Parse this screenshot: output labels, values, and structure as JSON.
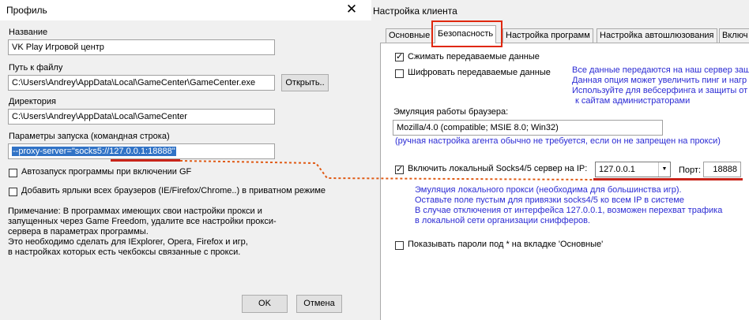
{
  "profile": {
    "title": "Профиль",
    "close_glyph": "✕",
    "name_label": "Название",
    "name_value": "VK Play Игровой центр",
    "path_label": "Путь к файлу",
    "path_value": "C:\\Users\\Andrey\\AppData\\Local\\GameCenter\\GameCenter.exe",
    "open_button": "Открыть..",
    "dir_label": "Директория",
    "dir_value": "C:\\Users\\Andrey\\AppData\\Local\\GameCenter",
    "params_label": "Параметры запуска (командная строка)",
    "params_value": "--proxy-server=\"socks5://127.0.0.1:18888\"",
    "autostart_label": "Автозапуск программы при включении GF",
    "autostart_checked": false,
    "shortcuts_label": "Добавить ярлыки всех браузеров (IE/Firefox/Chrome..) в приватном режиме",
    "shortcuts_checked": false,
    "note_lines": [
      "Примечание: В программах имеющих свои настройки прокси и",
      "запущенных через Game Freedom, удалите все настройки прокси-",
      "сервера в параметрах  программы.",
      "Это необходимо сделать для IExplorer, Opera, Firefox и игр,",
      "в настройках которых есть чекбоксы связанные с прокси."
    ],
    "ok_button": "OK",
    "cancel_button": "Отмена"
  },
  "client": {
    "title": "Настройка клиента",
    "tabs": [
      {
        "label": "Основные",
        "active": false
      },
      {
        "label": "Безопасность",
        "active": true
      },
      {
        "label": "Настройка программ",
        "active": false
      },
      {
        "label": "Настройка автошлюзования",
        "active": false
      },
      {
        "label": "Включ",
        "active": false
      }
    ],
    "compress_label": "Сжимать передаваемые данные",
    "compress_checked": true,
    "encrypt_label": "Шифровать передаваемые данные",
    "encrypt_checked": false,
    "encrypt_note_lines": [
      "Все данные передаются на наш сервер заш",
      "Данная опция может увеличить пинг и нагр",
      "Используйте для вебсерфинга и защиты от",
      "к сайтам администраторами"
    ],
    "browser_emul_label": "Эмуляция работы браузера:",
    "user_agent_value": "Mozilla/4.0 (compatible; MSIE 8.0; Win32)",
    "user_agent_note": "(ручная настройка агента обычно не требуется, если он не запрещен на прокси)",
    "socks_label": "Включить локальный Socks4/5 сервер на IP:",
    "socks_checked": true,
    "ip_value": "127.0.0.1",
    "port_label": "Порт:",
    "port_value": "18888",
    "socks_note_lines": [
      "Эмуляция локального прокси (необходима для большинства игр).",
      "Оставьте поле пустым для привязки socks4/5  ко всем IP в системе",
      "В случае отключения от интерфейса 127.0.0.1, возможен перехват трафика",
      "в локальной сети организации снифферов."
    ],
    "show_passwords_label": "Показывать пароли под * на вкладке 'Основные'",
    "show_passwords_checked": false
  },
  "colors": {
    "dialog_bg": "#f0f0f0",
    "selection": "#3173c6",
    "annotation_red": "#e0280e",
    "note_blue": "#2b2bd4",
    "connector_orange": "#e05a14"
  }
}
